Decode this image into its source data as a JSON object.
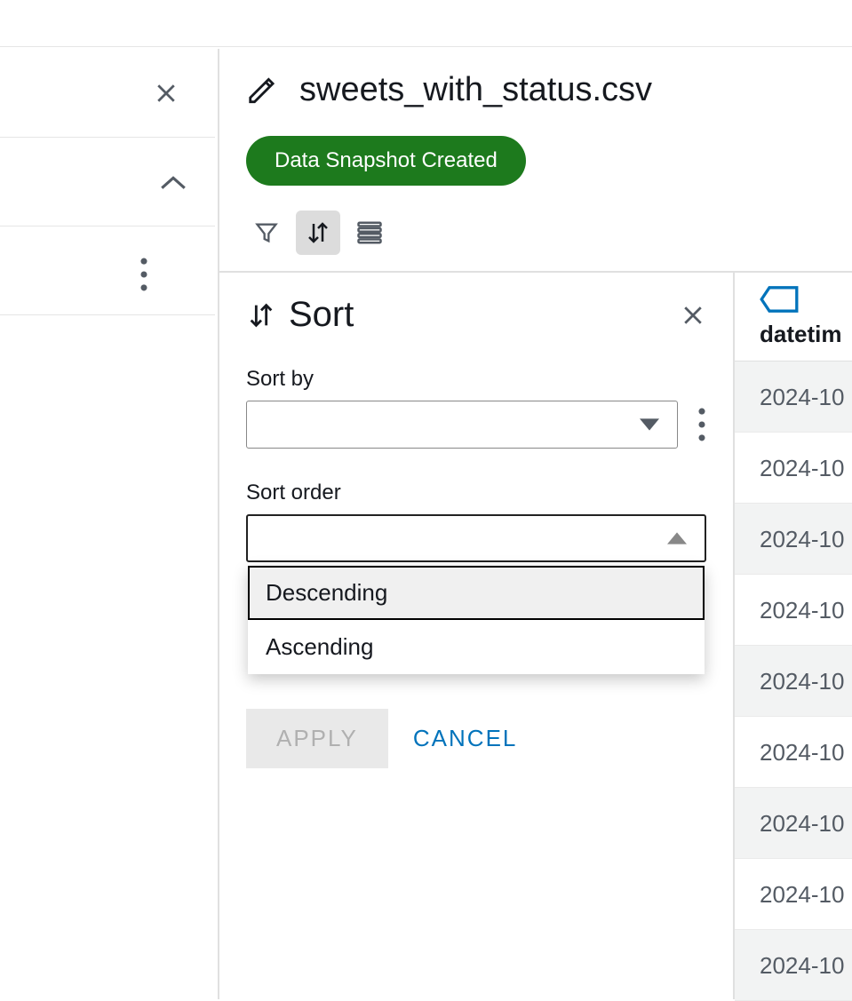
{
  "file": {
    "title": "sweets_with_status.csv"
  },
  "status": {
    "label": "Data Snapshot Created"
  },
  "sort_panel": {
    "title": "Sort",
    "sort_by_label": "Sort by",
    "sort_by_value": "",
    "sort_order_label": "Sort order",
    "sort_order_value": "",
    "options": {
      "descending": "Descending",
      "ascending": "Ascending"
    },
    "apply_label": "APPLY",
    "cancel_label": "CANCEL"
  },
  "table": {
    "column_header": "datetim",
    "rows": [
      "2024-10",
      "2024-10",
      "2024-10",
      "2024-10",
      "2024-10",
      "2024-10",
      "2024-10",
      "2024-10",
      "2024-10"
    ]
  }
}
